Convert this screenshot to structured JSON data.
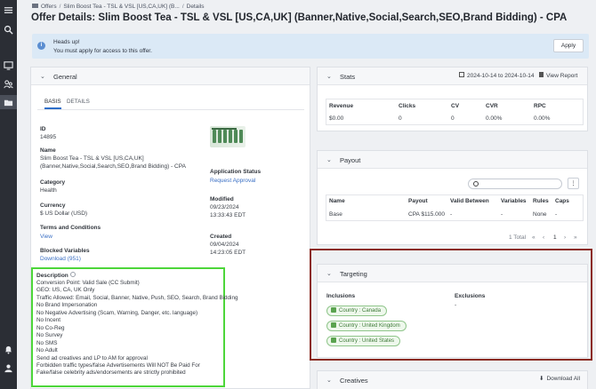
{
  "rail": {
    "icons": [
      "menu-icon",
      "search-icon",
      "dashboard-icon",
      "affiliates-icon",
      "offers-icon",
      "notifications-icon",
      "user-icon"
    ]
  },
  "breadcrumb": {
    "items": [
      "Offers",
      "Slim Boost Tea - TSL & VSL [US,CA,UK] (B...",
      "Details"
    ]
  },
  "page": {
    "title": "Offer Details: Slim Boost Tea - TSL & VSL [US,CA,UK] (Banner,Native,Social,Search,SEO,Brand Bidding) - CPA"
  },
  "alert": {
    "heading": "Heads up!",
    "body": "You must apply for access to this offer.",
    "button": "Apply"
  },
  "general": {
    "header": "General",
    "tabs": [
      "BASIS",
      "DETAILS"
    ],
    "id_label": "ID",
    "id_value": "14895",
    "name_label": "Name",
    "name_line1": "Slim Boost Tea - TSL & VSL [US,CA,UK]",
    "name_line2": "(Banner,Native,Social,Search,SEO,Brand Bidding) - CPA",
    "category_label": "Category",
    "category_value": "Health",
    "currency_label": "Currency",
    "currency_value": "$ US Dollar (USD)",
    "terms_label": "Terms and Conditions",
    "terms_link": "View",
    "blocked_label": "Blocked Variables",
    "blocked_link": "Download (951)",
    "app_status_label": "Application Status",
    "app_status_link": "Request Approval",
    "modified_label": "Modified",
    "modified_date": "09/23/2024",
    "modified_time": "13:33:43 EDT",
    "created_label": "Created",
    "created_date": "09/04/2024",
    "created_time": "14:23:05 EDT"
  },
  "description": {
    "label": "Description",
    "lines": [
      "Conversion Point: Valid Sale (CC Submit)",
      "GEO: US, CA, UK Only",
      "Traffic Allowed: Email, Social, Banner, Native, Push, SEO, Search, Brand Bidding",
      "No Brand Impersonation",
      "No Negative Advertising (Scam, Warning, Danger, etc. language)",
      "No Incent",
      "No Co-Reg",
      "No Survey",
      "No SMS",
      "No Adult",
      "Send ad creatives and LP to AM for approval",
      "Forbidden traffic types/false Advertisements Will NOT Be Paid For",
      "Fake/false celebrity ads/endorsements are strictly prohibited"
    ]
  },
  "stats": {
    "header": "Stats",
    "date_range": "2024-10-14 to 2024-10-14",
    "view_report": "View Report",
    "columns": [
      "Revenue",
      "Clicks",
      "CV",
      "CVR",
      "RPC"
    ],
    "row": [
      "$0.00",
      "0",
      "0",
      "0.00%",
      "0.00%"
    ]
  },
  "payout": {
    "header": "Payout",
    "columns": [
      "Name",
      "Payout",
      "Valid Between",
      "Variables",
      "Rules",
      "Caps"
    ],
    "row": [
      "Base",
      "CPA $115.000",
      "-",
      "-",
      "None",
      "-"
    ],
    "total": "1 Total",
    "page": "1",
    "first": "«",
    "prev": "‹",
    "next": "›",
    "last": "»"
  },
  "targeting": {
    "header": "Targeting",
    "inclusions_label": "Inclusions",
    "exclusions_label": "Exclusions",
    "exclusions_value": "-",
    "inclusions": [
      "Country : Canada",
      "Country : United Kingdom",
      "Country : United States"
    ]
  },
  "creatives": {
    "header": "Creatives",
    "download": "Download All"
  }
}
